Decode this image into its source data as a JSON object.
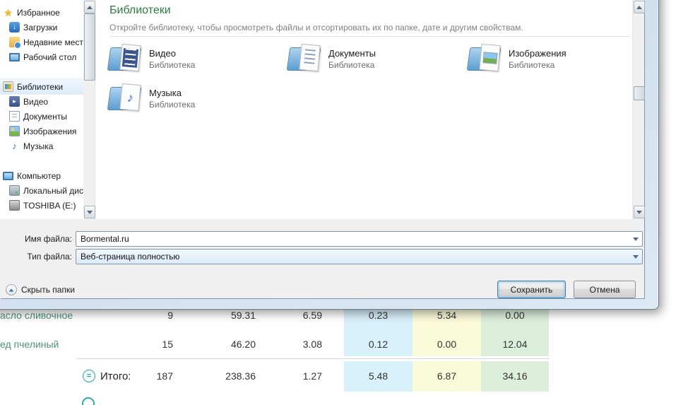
{
  "colors": {
    "header_green": "#2b7d3d",
    "link_teal": "#52907c",
    "accent_blue": "#3c7fb1",
    "frame_blue": "#c5d7ea",
    "cell_blue": "#d9f1fb",
    "cell_yellow": "#fafbd9",
    "cell_green": "#dcefdb"
  },
  "icons": {
    "star": "★",
    "download_arrow": "↓",
    "play": "▸",
    "music_note": "♪",
    "equals": "="
  },
  "dialog": {
    "nav": {
      "items": [
        {
          "label": "Избранное"
        },
        {
          "label": "Загрузки"
        },
        {
          "label": "Недавние места"
        },
        {
          "label": "Рабочий стол"
        },
        {
          "label": "Библиотеки"
        },
        {
          "label": "Видео"
        },
        {
          "label": "Документы"
        },
        {
          "label": "Изображения"
        },
        {
          "label": "Музыка"
        },
        {
          "label": "Компьютер"
        },
        {
          "label": "Локальный диск"
        },
        {
          "label": "TOSHIBA (E:)"
        }
      ]
    },
    "content": {
      "title": "Библиотеки",
      "subtitle": "Откройте библиотеку, чтобы просмотреть файлы и отсортировать их по папке, дате и другим свойствам.",
      "tiles": [
        {
          "name": "Видео",
          "type_label": "Библиотека"
        },
        {
          "name": "Документы",
          "type_label": "Библиотека"
        },
        {
          "name": "Изображения",
          "type_label": "Библиотека"
        },
        {
          "name": "Музыка",
          "type_label": "Библиотека"
        }
      ]
    },
    "fields": {
      "filename_label": "Имя файла:",
      "filename_value": "Bormental.ru",
      "filetype_label": "Тип файла:",
      "filetype_value": "Веб-страница полностью"
    },
    "footer": {
      "hide_folders": "Скрыть папки",
      "save": "Сохранить",
      "cancel": "Отмена"
    }
  },
  "page": {
    "table": {
      "rows": [
        {
          "name": "асло сливочное",
          "qty": "9",
          "kcal": "59.31",
          "per": "6.59",
          "c1": "0.23",
          "c2": "5.34",
          "c3": "0.00"
        },
        {
          "name": "ед пчелиный",
          "qty": "15",
          "kcal": "46.20",
          "per": "3.08",
          "c1": "0.12",
          "c2": "0.00",
          "c3": "12.04"
        }
      ],
      "total": {
        "label": "Итого:",
        "qty": "187",
        "kcal": "238.36",
        "per": "1.27",
        "c1": "5.48",
        "c2": "6.87",
        "c3": "34.16"
      }
    }
  }
}
